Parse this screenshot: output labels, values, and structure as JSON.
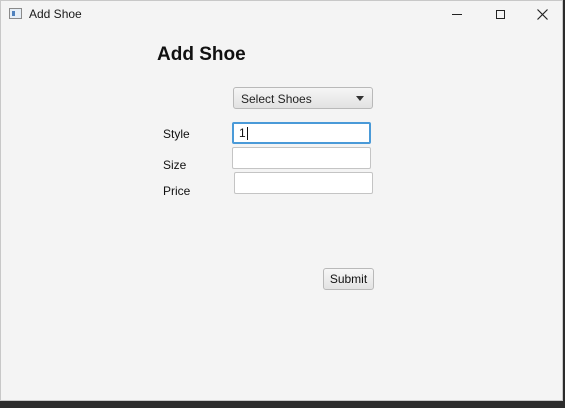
{
  "window": {
    "title": "Add Shoe"
  },
  "form": {
    "heading": "Add Shoe",
    "shoe_select": {
      "selected": "Select Shoes"
    },
    "style": {
      "label": "Style",
      "value": "1"
    },
    "size": {
      "label": "Size",
      "value": ""
    },
    "price": {
      "label": "Price",
      "value": ""
    },
    "submit_label": "Submit"
  },
  "icons": {
    "app": "window-app-icon",
    "minimize": "minimize-icon",
    "maximize": "maximize-icon",
    "close": "close-icon",
    "dropdown": "chevron-down-icon"
  },
  "colors": {
    "focus_border": "#4a9ad8",
    "background": "#f4f4f4"
  }
}
